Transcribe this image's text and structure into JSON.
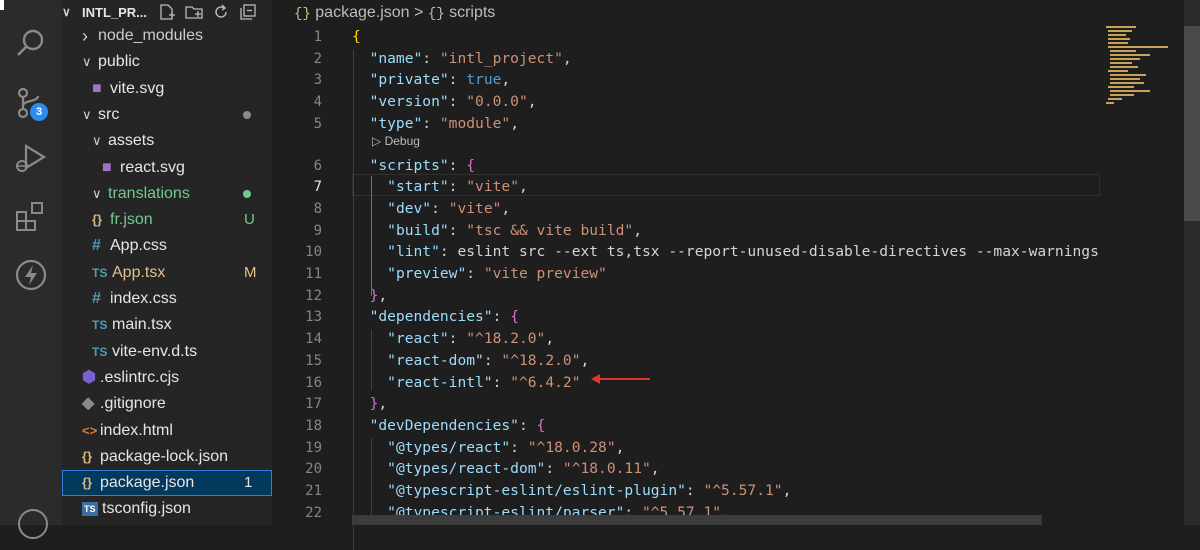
{
  "activity_bar": {
    "scm_badge": "3"
  },
  "explorer": {
    "title": "INTL_PR...",
    "items": [
      {
        "label": "node_modules",
        "kind": "folder-collapsed",
        "color": "#cccccc"
      },
      {
        "label": "public",
        "kind": "folder-open",
        "color": "#e6e6e6"
      },
      {
        "label": "vite.svg",
        "kind": "svg",
        "color": "#e6e6e6"
      },
      {
        "label": "src",
        "kind": "folder-open",
        "color": "#e6e6e6"
      },
      {
        "label": "assets",
        "kind": "folder-open",
        "color": "#e6e6e6"
      },
      {
        "label": "react.svg",
        "kind": "svg",
        "color": "#e6e6e6"
      },
      {
        "label": "translations",
        "kind": "folder-open",
        "color": "#73c991"
      },
      {
        "label": "fr.json",
        "kind": "json",
        "icon": "{}",
        "color": "#73c991",
        "status": "U"
      },
      {
        "label": "App.css",
        "kind": "css",
        "icon": "#",
        "color": "#e6e6e6"
      },
      {
        "label": "App.tsx",
        "kind": "ts",
        "icon": "TS",
        "color": "#e2c08d",
        "status": "M"
      },
      {
        "label": "index.css",
        "kind": "css",
        "icon": "#",
        "color": "#e6e6e6"
      },
      {
        "label": "main.tsx",
        "kind": "ts",
        "icon": "TS",
        "color": "#e6e6e6"
      },
      {
        "label": "vite-env.d.ts",
        "kind": "ts",
        "icon": "TS",
        "color": "#e6e6e6"
      },
      {
        "label": ".eslintrc.cjs",
        "kind": "eslint",
        "color": "#e6e6e6"
      },
      {
        "label": ".gitignore",
        "kind": "git",
        "color": "#e6e6e6"
      },
      {
        "label": "index.html",
        "kind": "html",
        "icon": "<>",
        "color": "#e6e6e6"
      },
      {
        "label": "package-lock.json",
        "kind": "json",
        "icon": "{}",
        "color": "#e6e6e6"
      },
      {
        "label": "package.json",
        "kind": "json",
        "icon": "{}",
        "color": "#e6e6e6",
        "status": "1",
        "selected": true
      },
      {
        "label": "tsconfig.json",
        "kind": "tsconfig",
        "icon": "TS",
        "color": "#e6e6e6"
      }
    ],
    "src_dot_color": "#8a8a8a",
    "translations_dot_color": "#73c991"
  },
  "breadcrumb": {
    "file": "package.json",
    "separator": ">",
    "section": "scripts",
    "brace_icon": "{}"
  },
  "editor": {
    "codelens": "Debug",
    "active_line": 7,
    "lines": [
      {
        "n": "1",
        "text": "{"
      },
      {
        "n": "2",
        "text": "  \"name\": \"intl_project\","
      },
      {
        "n": "3",
        "text": "  \"private\": true,"
      },
      {
        "n": "4",
        "text": "  \"version\": \"0.0.0\","
      },
      {
        "n": "5",
        "text": "  \"type\": \"module\","
      },
      {
        "n": "6",
        "text": "  \"scripts\": {"
      },
      {
        "n": "7",
        "text": "    \"start\": \"vite\","
      },
      {
        "n": "8",
        "text": "    \"dev\": \"vite\","
      },
      {
        "n": "9",
        "text": "    \"build\": \"tsc && vite build\","
      },
      {
        "n": "10",
        "text": "    \"lint\": \"eslint src --ext ts,tsx --report-unused-disable-directives --max-warnings"
      },
      {
        "n": "11",
        "text": "    \"preview\": \"vite preview\""
      },
      {
        "n": "12",
        "text": "  },"
      },
      {
        "n": "13",
        "text": "  \"dependencies\": {"
      },
      {
        "n": "14",
        "text": "    \"react\": \"^18.2.0\","
      },
      {
        "n": "15",
        "text": "    \"react-dom\": \"^18.2.0\","
      },
      {
        "n": "16",
        "text": "    \"react-intl\": \"^6.4.2\""
      },
      {
        "n": "17",
        "text": "  },"
      },
      {
        "n": "18",
        "text": "  \"devDependencies\": {"
      },
      {
        "n": "19",
        "text": "    \"@types/react\": \"^18.0.28\","
      },
      {
        "n": "20",
        "text": "    \"@types/react-dom\": \"^18.0.11\","
      },
      {
        "n": "21",
        "text": "    \"@typescript-eslint/eslint-plugin\": \"^5.57.1\","
      },
      {
        "n": "22",
        "text": "    \"@typescript-eslint/parser\": \"^5.57.1\","
      }
    ],
    "annotation_color": "#e0352b"
  }
}
